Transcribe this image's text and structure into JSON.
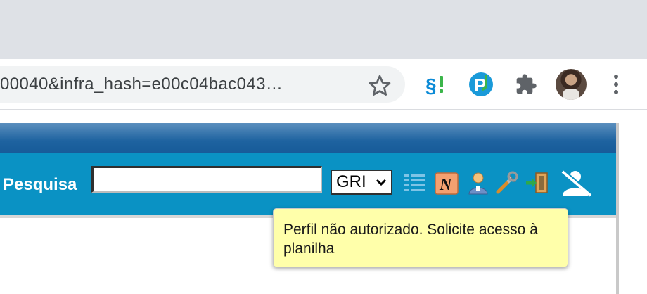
{
  "browser": {
    "url_text": "00040&infra_hash=e00c04bac043…",
    "bookmark_icon": "star-icon",
    "extensions": [
      {
        "name": "sei-extension-icon",
        "label": "§!"
      },
      {
        "name": "p-extension-icon",
        "label": "P"
      },
      {
        "name": "puzzle-extensions-icon",
        "label": ""
      }
    ],
    "menu_icon": "kebab-menu-icon"
  },
  "app": {
    "search_label": "Pesquisa",
    "search_value": "",
    "unit_select_value": "GRI",
    "toolbar_icons": [
      "list-icon",
      "notes-n-icon",
      "user-profile-icon",
      "tools-wrench-icon",
      "exit-door-icon",
      "user-unauthorized-icon"
    ]
  },
  "tooltip": {
    "text": "Perfil não autorizado. Solicite acesso à planilha"
  },
  "colors": {
    "chrome_tabstrip": "#dee1e6",
    "app_bar": "#0a92c4",
    "app_topband": "#1e63a0",
    "tooltip_bg": "#ffffaa",
    "extension_blue": "#0b8ad6",
    "extension_green": "#3bb54a"
  }
}
